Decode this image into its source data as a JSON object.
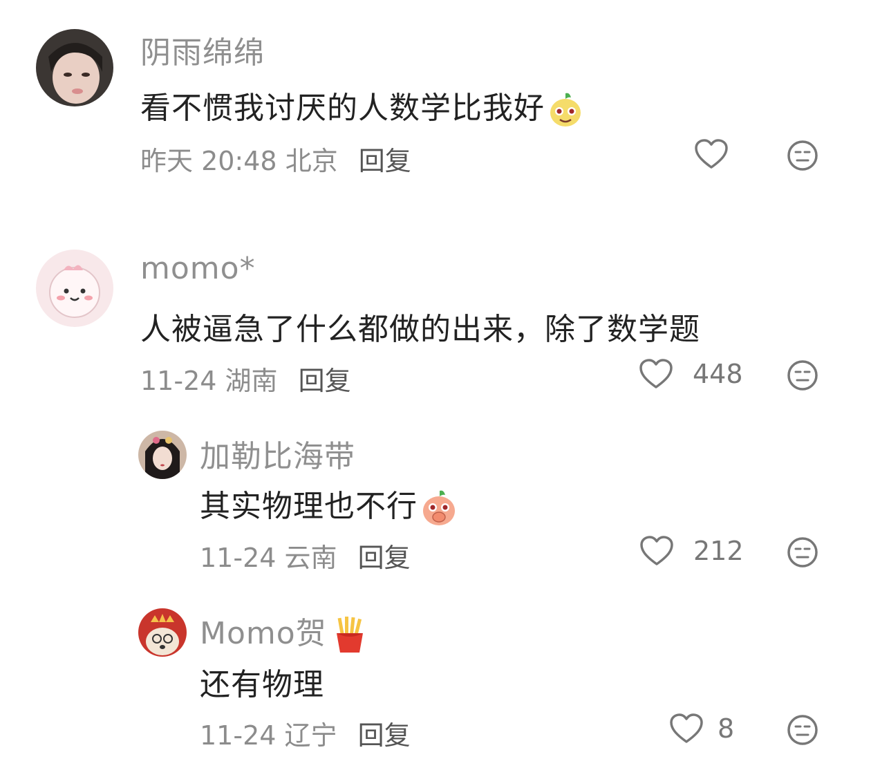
{
  "comments": [
    {
      "username": "阴雨绵绵",
      "text": "看不惯我讨厌的人数学比我好",
      "emoji": "smirking-pear-emoji",
      "time": "昨天 20:48",
      "location": "北京",
      "reply_label": "回复",
      "likes": ""
    },
    {
      "username": "momo*",
      "text": "人被逼急了什么都做的出来，除了数学题",
      "emoji": "",
      "time": "11-24",
      "location": "湖南",
      "reply_label": "回复",
      "likes": "448"
    },
    {
      "username": "加勒比海带",
      "text": "其实物理也不行",
      "emoji": "covering-mouth-peach-emoji",
      "time": "11-24",
      "location": "云南",
      "reply_label": "回复",
      "likes": "212"
    },
    {
      "username": "Momo贺",
      "badge_icon": "french-fries-icon",
      "text": "还有物理",
      "emoji": "",
      "time": "11-24",
      "location": "辽宁",
      "reply_label": "回复",
      "likes": "8"
    }
  ],
  "icons": {
    "like": "heart-outline-icon",
    "dislike": "neutral-face-icon"
  },
  "colors": {
    "username": "#8f8f8f",
    "text": "#222222",
    "meta": "#8c8c8c",
    "icon": "#777777"
  }
}
